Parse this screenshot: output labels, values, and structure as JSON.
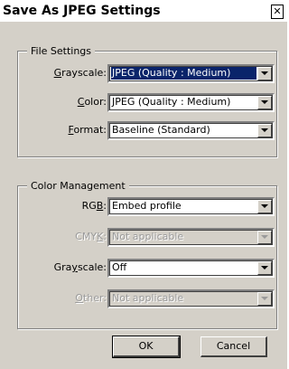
{
  "dialog": {
    "title": "Save As JPEG Settings",
    "close_glyph": "✕"
  },
  "file_settings": {
    "legend": "File Settings",
    "rows": [
      {
        "label_pre": "",
        "label_key": "G",
        "label_post": "rayscale:",
        "value": "JPEG (Quality : Medium)",
        "selected": true,
        "enabled": true
      },
      {
        "label_pre": "",
        "label_key": "C",
        "label_post": "olor:",
        "value": "JPEG (Quality : Medium)",
        "selected": false,
        "enabled": true
      },
      {
        "label_pre": "",
        "label_key": "F",
        "label_post": "ormat:",
        "value": "Baseline (Standard)",
        "selected": false,
        "enabled": true
      }
    ]
  },
  "color_management": {
    "legend": "Color Management",
    "rows": [
      {
        "label_pre": "RG",
        "label_key": "B",
        "label_post": ":",
        "value": "Embed profile",
        "enabled": true
      },
      {
        "label_pre": "CMY",
        "label_key": "K",
        "label_post": ":",
        "value": "Not applicable",
        "enabled": false
      },
      {
        "label_pre": "Gra",
        "label_key": "y",
        "label_post": "scale:",
        "value": "Off",
        "enabled": true
      },
      {
        "label_pre": "",
        "label_key": "O",
        "label_post": "ther:",
        "value": "Not applicable",
        "enabled": false
      }
    ]
  },
  "buttons": {
    "ok": "OK",
    "cancel": "Cancel"
  },
  "colors": {
    "face": "#d4d0c8",
    "selection": "#0a246a",
    "disabled_text": "#9a9a9a"
  }
}
